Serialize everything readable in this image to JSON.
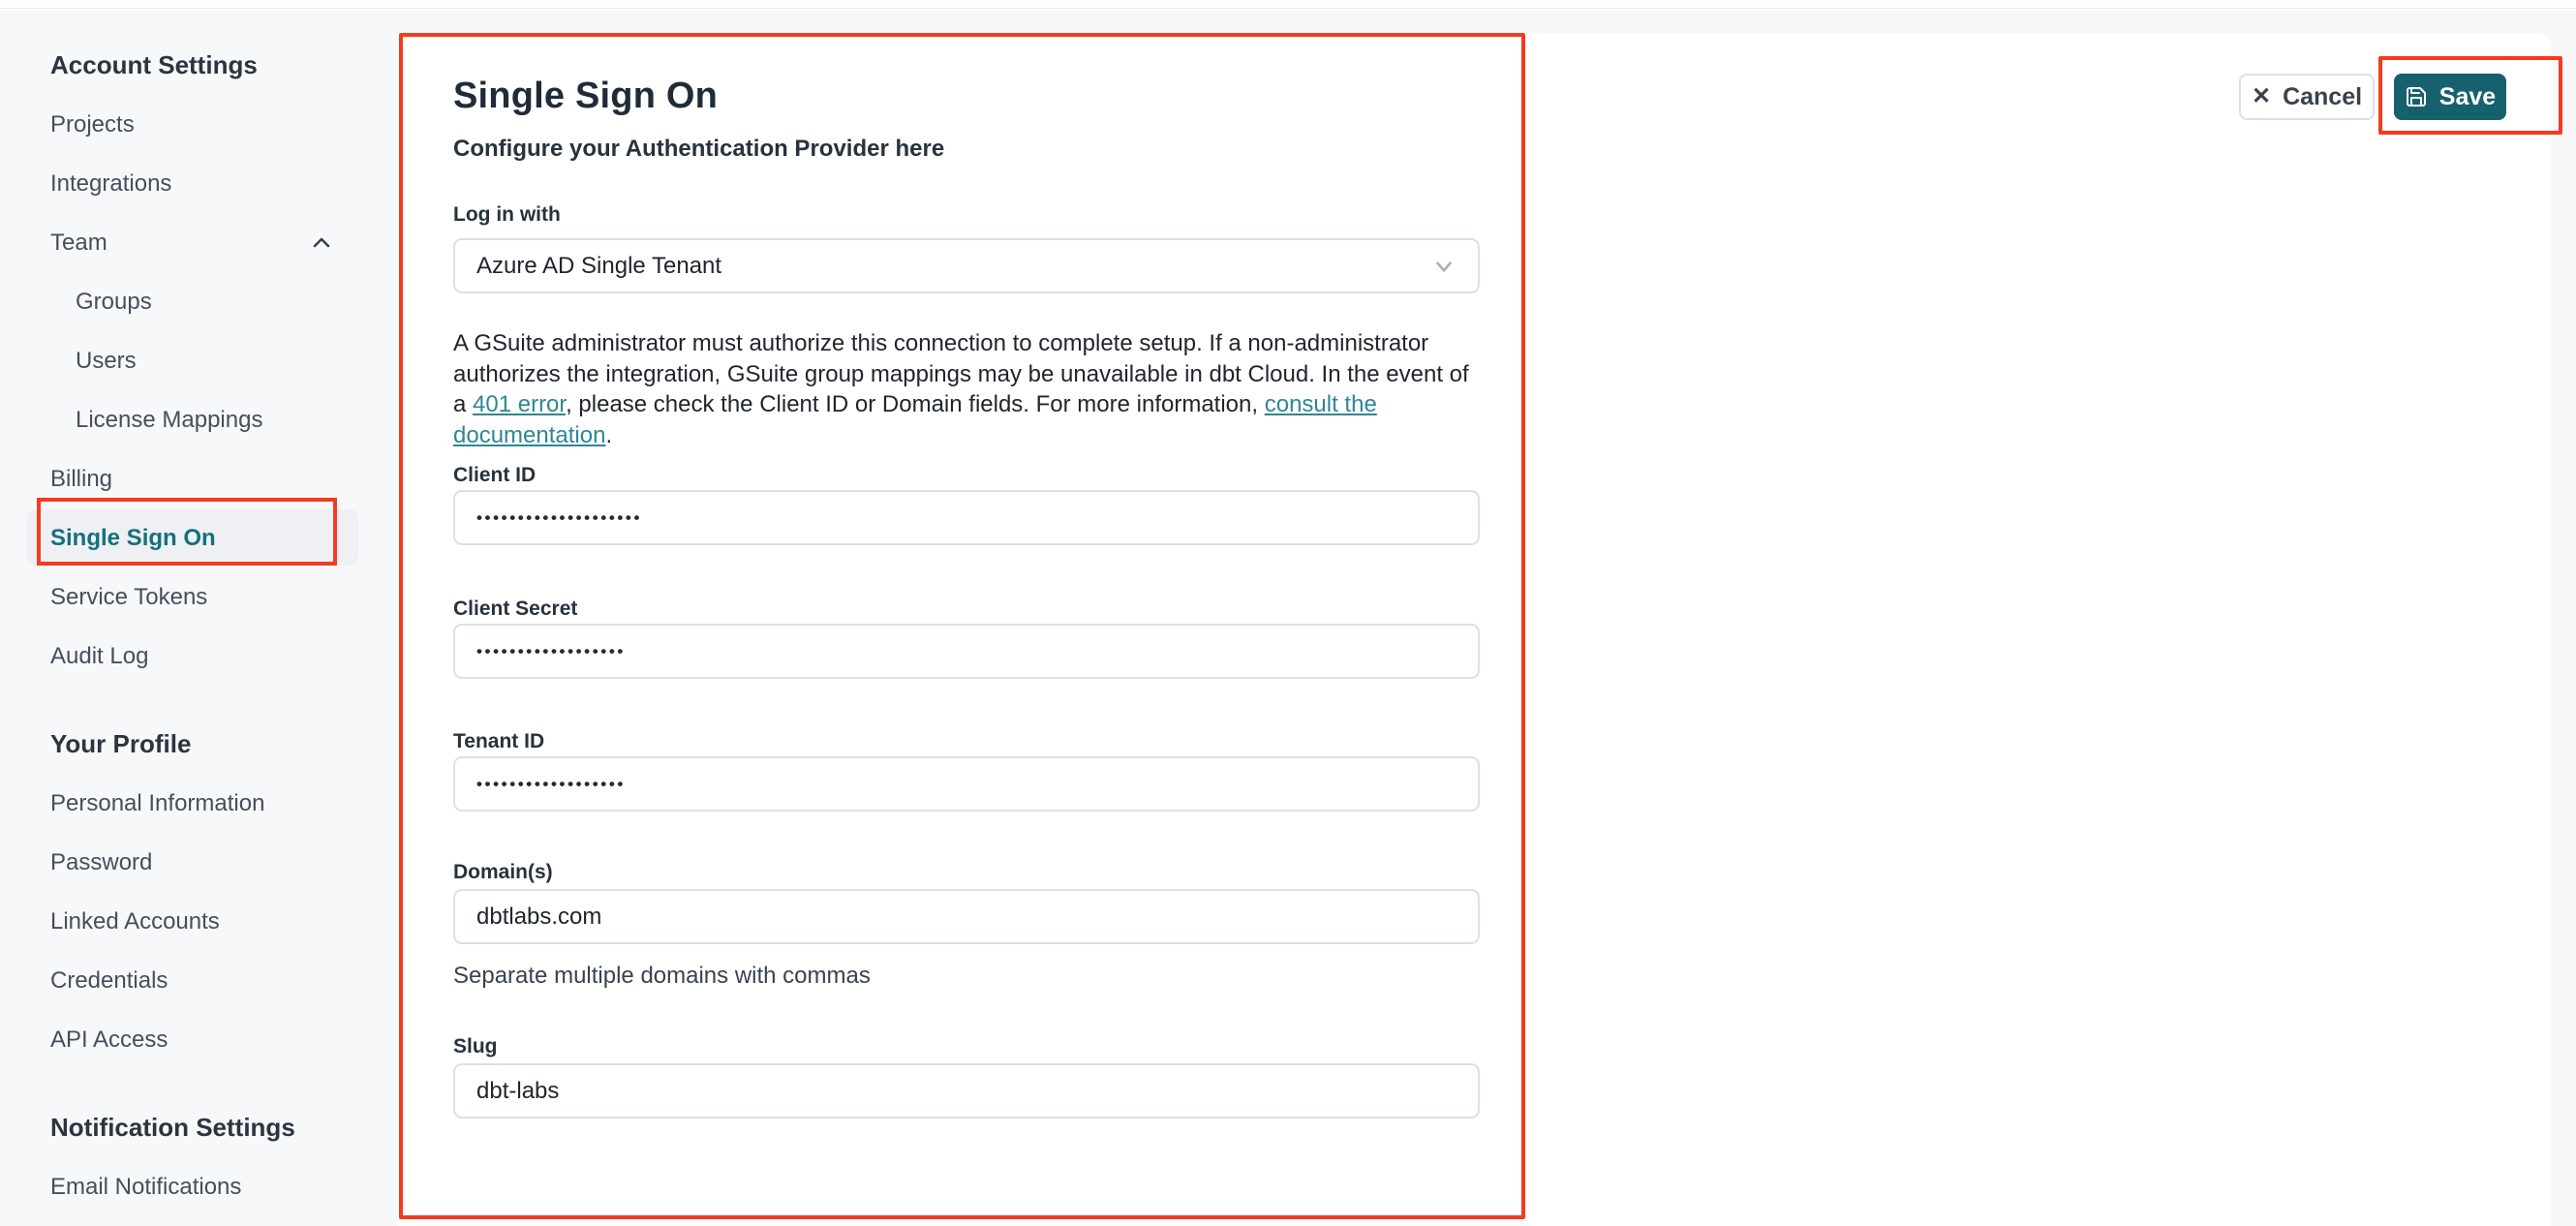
{
  "colors": {
    "annotation_red": "#f43b1f",
    "teal_accent": "#15707d",
    "save_button_bg": "#16616d",
    "page_bg": "#f7f8fa"
  },
  "sidebar": {
    "rows": [
      {
        "label": "Account Settings"
      },
      {
        "label": "Projects"
      },
      {
        "label": "Integrations"
      },
      {
        "label": "Team"
      },
      {
        "label": "Groups"
      },
      {
        "label": "Users"
      },
      {
        "label": "License Mappings"
      },
      {
        "label": "Billing"
      },
      {
        "label": "Single Sign On"
      },
      {
        "label": "Service Tokens"
      },
      {
        "label": "Audit Log"
      },
      {
        "label": "Your Profile"
      },
      {
        "label": "Personal Information"
      },
      {
        "label": "Password"
      },
      {
        "label": "Linked Accounts"
      },
      {
        "label": "Credentials"
      },
      {
        "label": "API Access"
      },
      {
        "label": "Notification Settings"
      },
      {
        "label": "Email Notifications"
      }
    ]
  },
  "main": {
    "title": "Single Sign On",
    "subtitle": "Configure your Authentication Provider here",
    "login_with": {
      "label": "Log in with",
      "value": "Azure AD Single Tenant"
    },
    "note": {
      "pre": "A GSuite administrator must authorize this connection to complete setup. If a non-administrator authorizes the integration, GSuite group mappings may be unavailable in dbt Cloud. In the event of a ",
      "link_401": "401 error",
      "mid": ", please check the Client ID or Domain fields. For more information, ",
      "link_docs": "consult the documentation",
      "post": "."
    },
    "fields": {
      "client_id": {
        "label": "Client ID",
        "value": "••••••••••••••••••••"
      },
      "client_secret": {
        "label": "Client Secret",
        "value": "••••••••••••••••••"
      },
      "tenant_id": {
        "label": "Tenant ID",
        "value": "••••••••••••••••••"
      },
      "domains": {
        "label": "Domain(s)",
        "value": "dbtlabs.com",
        "helper": "Separate multiple domains with commas"
      },
      "slug": {
        "label": "Slug",
        "value": "dbt-labs"
      }
    },
    "actions": {
      "cancel": "Cancel",
      "save": "Save"
    }
  }
}
